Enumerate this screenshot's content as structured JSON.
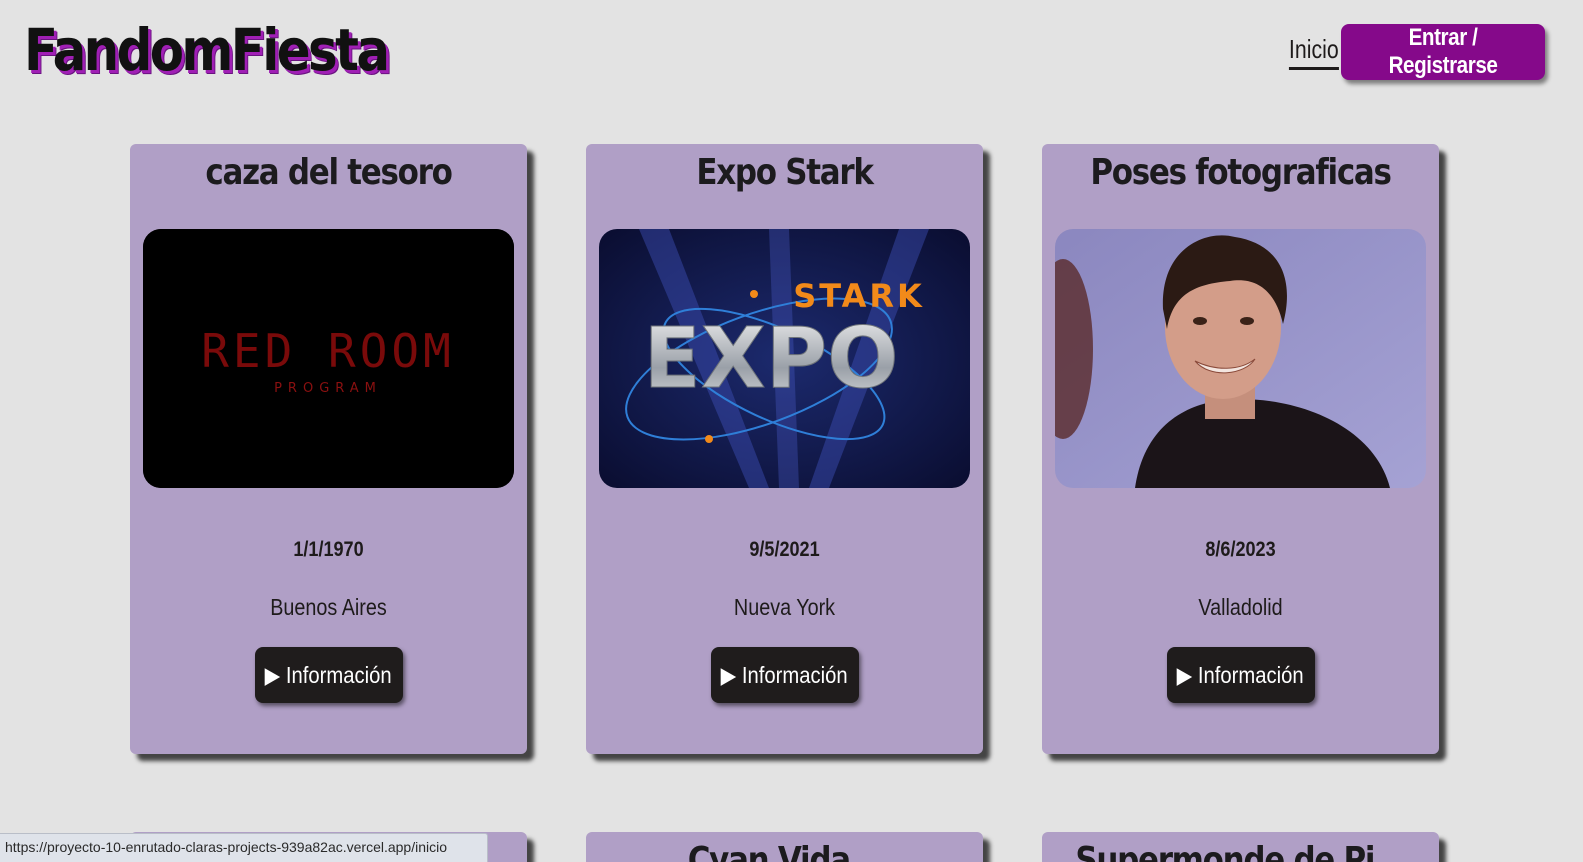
{
  "app": {
    "logo": "FandomFiesta"
  },
  "nav": {
    "home": "Inicio",
    "login": "Entrar / Registrarse"
  },
  "colors": {
    "accent": "#85098a",
    "card": "#b09fc6",
    "background": "#e3e3e3",
    "button": "#1f1c1c"
  },
  "events": [
    {
      "title": "caza del tesoro",
      "date": "1/1/1970",
      "city": "Buenos Aires",
      "button": "▶ Información",
      "image": {
        "icon": "red-room-program-logo",
        "logo_line1": "RED ROOM",
        "logo_line2": "PROGRAM"
      }
    },
    {
      "title": "Expo Stark",
      "date": "9/5/2021",
      "city": "Nueva York",
      "button": "▶ Información",
      "image": {
        "icon": "stark-expo-logo",
        "logo_line1": "STARK",
        "logo_line2": "EXPO"
      }
    },
    {
      "title": "Poses fotograficas",
      "date": "8/6/2023",
      "city": "Valladolid",
      "button": "▶ Información",
      "image": {
        "icon": "person-photo"
      }
    }
  ],
  "partial_events": [
    {
      "title": ""
    },
    {
      "title": "Cyan Vida..."
    },
    {
      "title": "Supermonde de Pi..."
    }
  ],
  "status_bar": {
    "url": "https://proyecto-10-enrutado-claras-projects-939a82ac.vercel.app/inicio"
  }
}
